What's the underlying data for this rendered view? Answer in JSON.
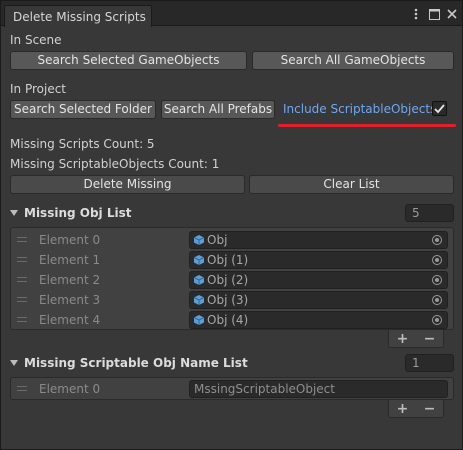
{
  "window": {
    "tab_title": "Delete Missing Scripts"
  },
  "in_scene": {
    "label": "In Scene",
    "search_selected_label": "Search Selected GameObjects",
    "search_all_label": "Search All GameObjects"
  },
  "in_project": {
    "label": "In Project",
    "search_folder_label": "Search Selected Folder",
    "search_prefabs_label": "Search All Prefabs",
    "include_so_label": "Include ScriptableObjects",
    "include_so_checked": true
  },
  "counts": {
    "missing_scripts": "Missing Scripts Count: 5",
    "missing_so": "Missing ScriptableObjects Count: 1"
  },
  "actions": {
    "delete_label": "Delete Missing",
    "clear_label": "Clear List"
  },
  "missing_obj_list": {
    "title": "Missing Obj List",
    "count": "5",
    "items": [
      {
        "label": "Element 0",
        "value": "Obj"
      },
      {
        "label": "Element 1",
        "value": "Obj (1)"
      },
      {
        "label": "Element 2",
        "value": "Obj (2)"
      },
      {
        "label": "Element 3",
        "value": "Obj (3)"
      },
      {
        "label": "Element 4",
        "value": "Obj (4)"
      }
    ],
    "add": "+",
    "remove": "−"
  },
  "missing_so_list": {
    "title": "Missing Scriptable Obj Name List",
    "count": "1",
    "items": [
      {
        "label": "Element 0",
        "value": "MssingScriptableObject"
      }
    ],
    "add": "+",
    "remove": "−"
  },
  "colors": {
    "accent_link": "#6ea8f0",
    "highlight": "#e0202a",
    "panel": "#383838"
  }
}
